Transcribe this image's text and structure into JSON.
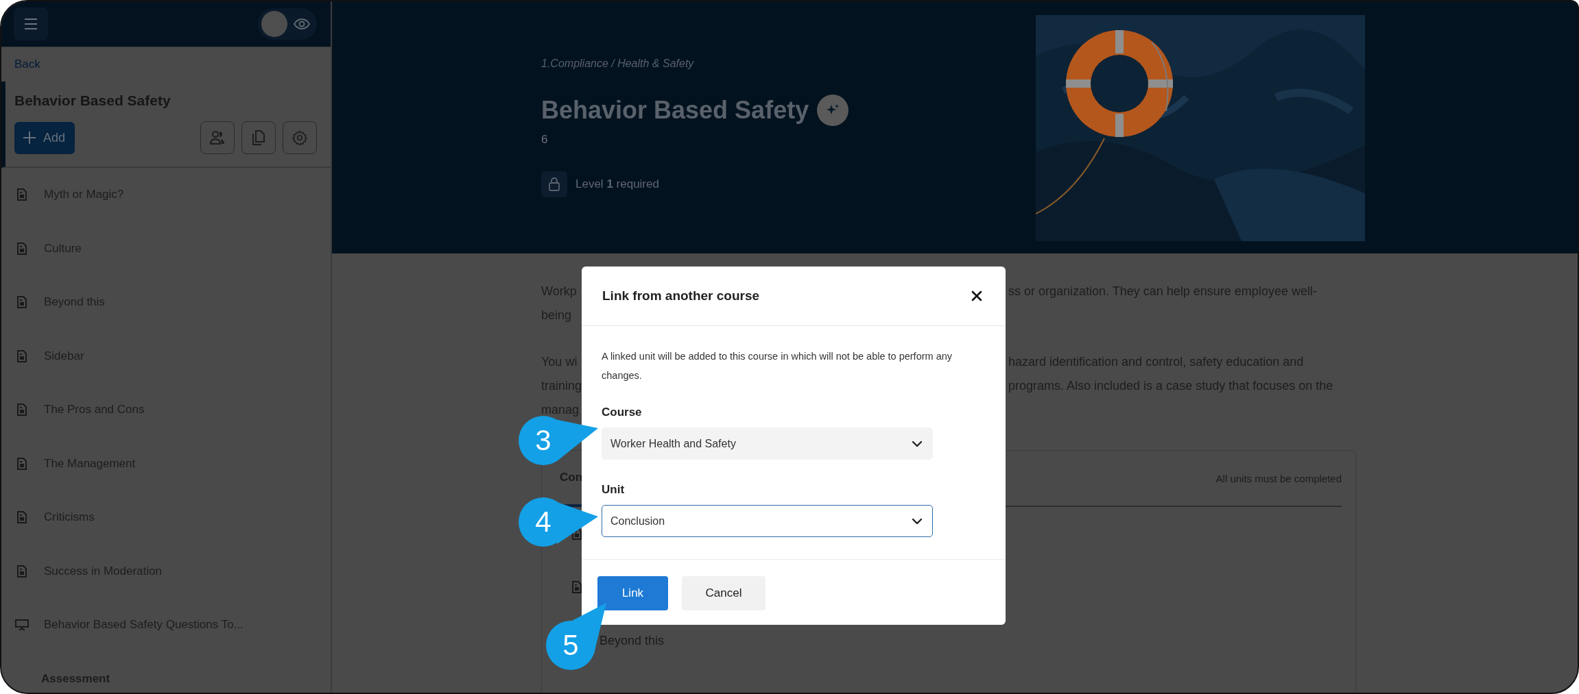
{
  "sidebar": {
    "preview": {
      "on": false
    },
    "back": "Back",
    "course_title": "Behavior Based Safety",
    "add_button": "Add",
    "items": [
      {
        "kind": "page",
        "label": "Myth or Magic?"
      },
      {
        "kind": "page",
        "label": "Culture"
      },
      {
        "kind": "page",
        "label": "Beyond this"
      },
      {
        "kind": "page",
        "label": "Sidebar"
      },
      {
        "kind": "page",
        "label": "The Pros and Cons"
      },
      {
        "kind": "page",
        "label": "The Management"
      },
      {
        "kind": "page",
        "label": "Criticisms"
      },
      {
        "kind": "page",
        "label": "Success in Moderation"
      },
      {
        "kind": "slides",
        "label": "Behavior Based Safety Questions To..."
      },
      {
        "kind": "section",
        "label": "Assessment"
      }
    ]
  },
  "header": {
    "breadcrumb": "1.Compliance / Health & Safety",
    "title": "Behavior Based Safety",
    "count": "6",
    "requirement": "Level **1** required"
  },
  "body": {
    "paragraphs": [
      {
        "lines": [
          {
            "left": "Workp",
            "right": "ss or organization. They can help ensure employee well-"
          },
          {
            "left": "being"
          }
        ]
      },
      {
        "lines": [
          {
            "left": "You wi",
            "right": "hazard identification and control, safety education and"
          },
          {
            "left": "training",
            "right": "programs. Also included is a case study that focuses on the"
          },
          {
            "left": "manag"
          }
        ]
      }
    ]
  },
  "units_card": {
    "tab": "Con",
    "note": "All units must be completed",
    "rows": [
      {
        "kind": "page"
      },
      {
        "kind": "page"
      },
      {
        "label": "Beyond this"
      }
    ]
  },
  "dialog": {
    "title": "Link from another course",
    "description": "A linked unit will be added to this course in which will not be able to perform any changes.",
    "fields": [
      {
        "label": "Course",
        "value": "Worker Health and Safety",
        "focused": false
      },
      {
        "label": "Unit",
        "value": "Conclusion",
        "focused": true
      }
    ],
    "buttons": [
      {
        "label": "Link",
        "kind": "primary"
      },
      {
        "label": "Cancel",
        "kind": "secondary"
      }
    ]
  },
  "callouts": [
    {
      "number": "3"
    },
    {
      "number": "4"
    },
    {
      "number": "5"
    }
  ]
}
